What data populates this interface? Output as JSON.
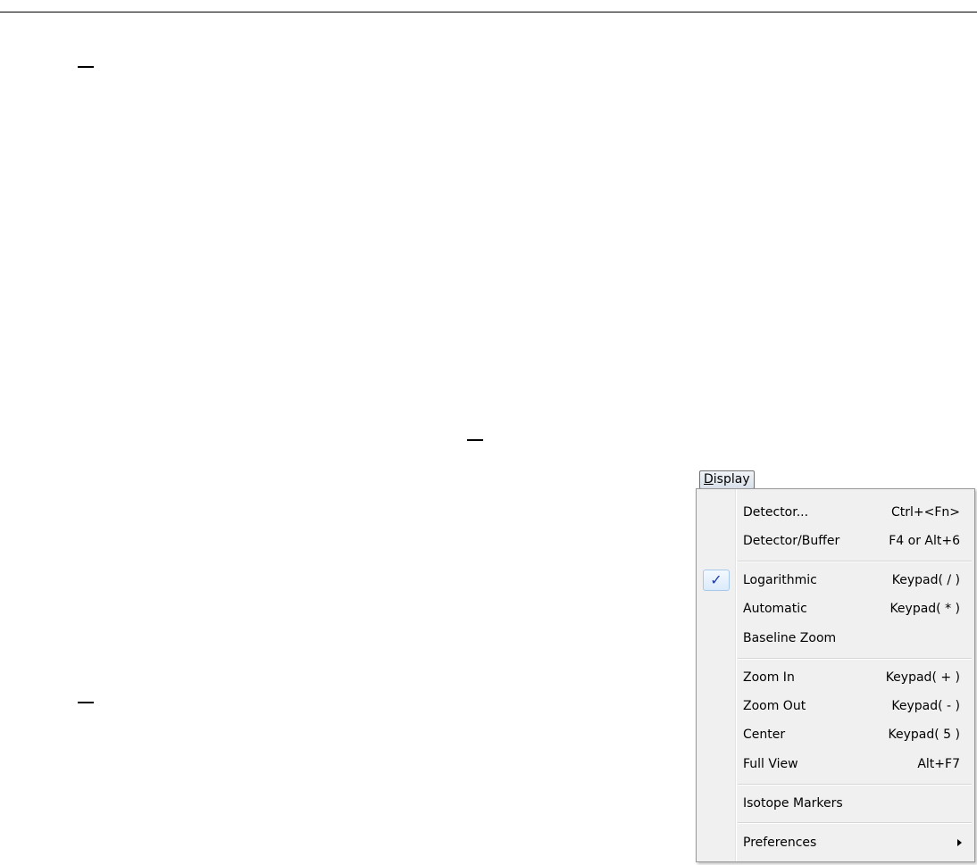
{
  "menu": {
    "title_accel": "D",
    "title_rest": "isplay",
    "groups": [
      {
        "items": [
          {
            "label": "Detector...",
            "shortcut": "Ctrl+<Fn>"
          },
          {
            "label": "Detector/Buffer",
            "shortcut": "F4 or Alt+6"
          }
        ]
      },
      {
        "items": [
          {
            "label": "Logarithmic",
            "shortcut": "Keypad( / )",
            "checked": true,
            "check_glyph": "✓"
          },
          {
            "label": "Automatic",
            "shortcut": "Keypad( * )"
          },
          {
            "label": "Baseline Zoom",
            "shortcut": ""
          }
        ]
      },
      {
        "items": [
          {
            "label": "Zoom In",
            "shortcut": "Keypad( + )"
          },
          {
            "label": "Zoom Out",
            "shortcut": "Keypad( - )"
          },
          {
            "label": "Center",
            "shortcut": "Keypad( 5 )"
          },
          {
            "label": "Full View",
            "shortcut": "Alt+F7"
          }
        ]
      },
      {
        "items": [
          {
            "label": "Isotope Markers",
            "shortcut": ""
          }
        ]
      },
      {
        "items": [
          {
            "label": "Preferences",
            "shortcut": "",
            "submenu": true,
            "submenu_icon": "chevron-right-icon"
          }
        ]
      }
    ]
  },
  "colors": {
    "menu_background": "#f0f0f0",
    "menu_border": "#979797",
    "check_color": "#1c3aa8"
  }
}
